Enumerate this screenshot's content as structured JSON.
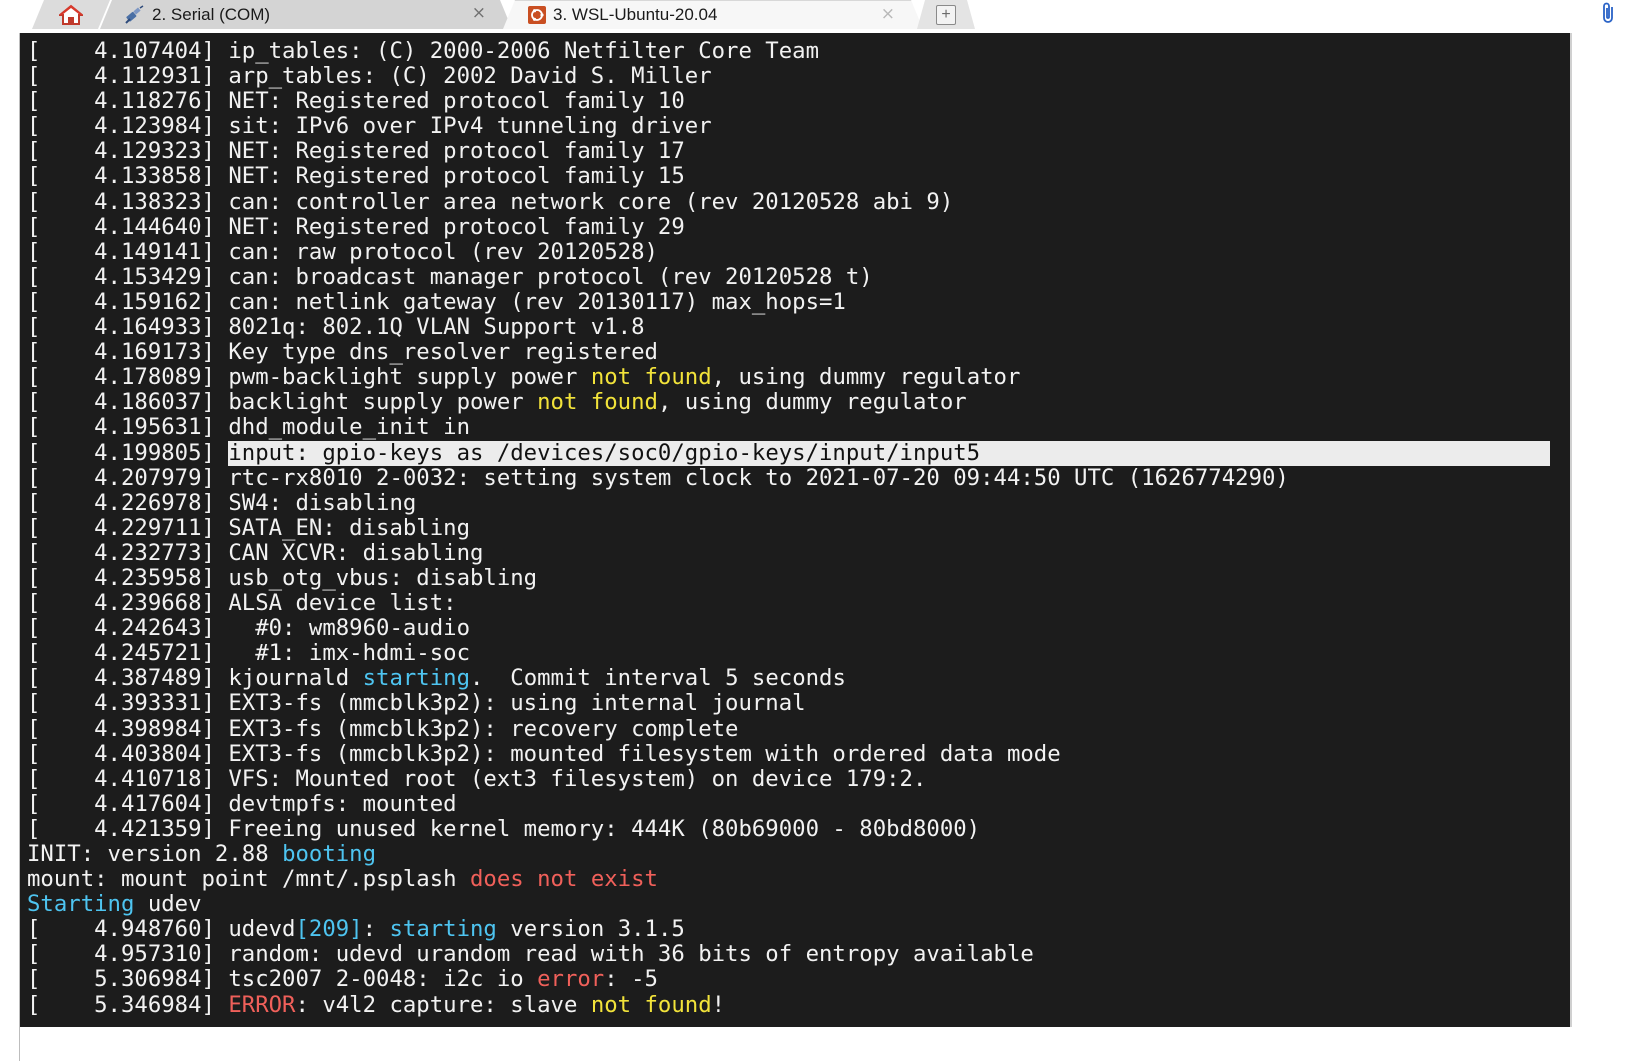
{
  "tabs": [
    {
      "label": "",
      "icon": "home-icon",
      "active": false
    },
    {
      "label": "2. Serial (COM)",
      "icon": "serial-plug-icon",
      "active": true
    },
    {
      "label": "3. WSL-Ubuntu-20.04",
      "icon": "ubuntu-terminal-icon",
      "active": false
    }
  ],
  "tab_close_glyph": "×",
  "new_tab_glyph": "+",
  "colors": {
    "terminal_bg": "#1c1c1c",
    "text": "#f2f2f2",
    "yellow": "#f2e33a",
    "cyan": "#4ec4f0",
    "red": "#f0605a",
    "highlight_bg": "#ececec"
  },
  "terminal": {
    "lines": [
      [
        {
          "t": "[    4.107404] ip_tables: (C) 2000-2006 Netfilter Core Team"
        }
      ],
      [
        {
          "t": "[    4.112931] arp_tables: (C) 2002 David S. Miller"
        }
      ],
      [
        {
          "t": "[    4.118276] NET: Registered protocol family 10"
        }
      ],
      [
        {
          "t": "[    4.123984] sit: IPv6 over IPv4 tunneling driver"
        }
      ],
      [
        {
          "t": "[    4.129323] NET: Registered protocol family 17"
        }
      ],
      [
        {
          "t": "[    4.133858] NET: Registered protocol family 15"
        }
      ],
      [
        {
          "t": "[    4.138323] can: controller area network core (rev 20120528 abi 9)"
        }
      ],
      [
        {
          "t": "[    4.144640] NET: Registered protocol family 29"
        }
      ],
      [
        {
          "t": "[    4.149141] can: raw protocol (rev 20120528)"
        }
      ],
      [
        {
          "t": "[    4.153429] can: broadcast manager protocol (rev 20120528 t)"
        }
      ],
      [
        {
          "t": "[    4.159162] can: netlink gateway (rev 20130117) max_hops=1"
        }
      ],
      [
        {
          "t": "[    4.164933] 8021q: 802.1Q VLAN Support v1.8"
        }
      ],
      [
        {
          "t": "[    4.169173] Key type dns_resolver registered"
        }
      ],
      [
        {
          "t": "[    4.178089] pwm-backlight supply power "
        },
        {
          "t": "not found",
          "c": "yellow"
        },
        {
          "t": ", using dummy regulator"
        }
      ],
      [
        {
          "t": "[    4.186037] backlight supply power "
        },
        {
          "t": "not found",
          "c": "yellow"
        },
        {
          "t": ", using dummy regulator"
        }
      ],
      [
        {
          "t": "[    4.195631] dhd_module_init in"
        }
      ],
      [
        {
          "t": "[    4.199805] "
        },
        {
          "t": "input: gpio-keys as /devices/soc0/gpio-keys/input/input5",
          "c": "hl"
        }
      ],
      [
        {
          "t": "[    4.207979] rtc-rx8010 2-0032: setting system clock to 2021-07-20 09:44:50 UTC (1626774290)"
        }
      ],
      [
        {
          "t": "[    4.226978] SW4: disabling"
        }
      ],
      [
        {
          "t": "[    4.229711] SATA_EN: disabling"
        }
      ],
      [
        {
          "t": "[    4.232773] CAN XCVR: disabling"
        }
      ],
      [
        {
          "t": "[    4.235958] usb_otg_vbus: disabling"
        }
      ],
      [
        {
          "t": "[    4.239668] ALSA device list:"
        }
      ],
      [
        {
          "t": "[    4.242643]   #0: wm8960-audio"
        }
      ],
      [
        {
          "t": "[    4.245721]   #1: imx-hdmi-soc"
        }
      ],
      [
        {
          "t": "[    4.387489] kjournald "
        },
        {
          "t": "starting",
          "c": "cyan"
        },
        {
          "t": ".  Commit interval 5 seconds"
        }
      ],
      [
        {
          "t": "[    4.393331] EXT3-fs (mmcblk3p2): using internal journal"
        }
      ],
      [
        {
          "t": "[    4.398984] EXT3-fs (mmcblk3p2): recovery complete"
        }
      ],
      [
        {
          "t": "[    4.403804] EXT3-fs (mmcblk3p2): mounted filesystem with ordered data mode"
        }
      ],
      [
        {
          "t": "[    4.410718] VFS: Mounted root (ext3 filesystem) on device 179:2."
        }
      ],
      [
        {
          "t": "[    4.417604] devtmpfs: mounted"
        }
      ],
      [
        {
          "t": "[    4.421359] Freeing unused kernel memory: 444K (80b69000 - 80bd8000)"
        }
      ],
      [
        {
          "t": "INIT: version 2.88 "
        },
        {
          "t": "booting",
          "c": "cyan"
        }
      ],
      [
        {
          "t": "mount: mount point /mnt/.psplash "
        },
        {
          "t": "does not exist",
          "c": "red"
        }
      ],
      [
        {
          "t": "Starting",
          "c": "cyan"
        },
        {
          "t": " udev"
        }
      ],
      [
        {
          "t": "[    4.948760] udevd"
        },
        {
          "t": "[209]",
          "c": "cyan"
        },
        {
          "t": ": "
        },
        {
          "t": "starting",
          "c": "cyan"
        },
        {
          "t": " version 3.1.5"
        }
      ],
      [
        {
          "t": "[    4.957310] random: udevd urandom read with 36 bits of entropy available"
        }
      ],
      [
        {
          "t": "[    5.306984] tsc2007 2-0048: i2c io "
        },
        {
          "t": "error",
          "c": "red"
        },
        {
          "t": ": -5"
        }
      ],
      [
        {
          "t": "[    5.346984] "
        },
        {
          "t": "ERROR",
          "c": "red"
        },
        {
          "t": ": v4l2 capture: slave "
        },
        {
          "t": "not found",
          "c": "yellow"
        },
        {
          "t": "!"
        }
      ]
    ]
  }
}
